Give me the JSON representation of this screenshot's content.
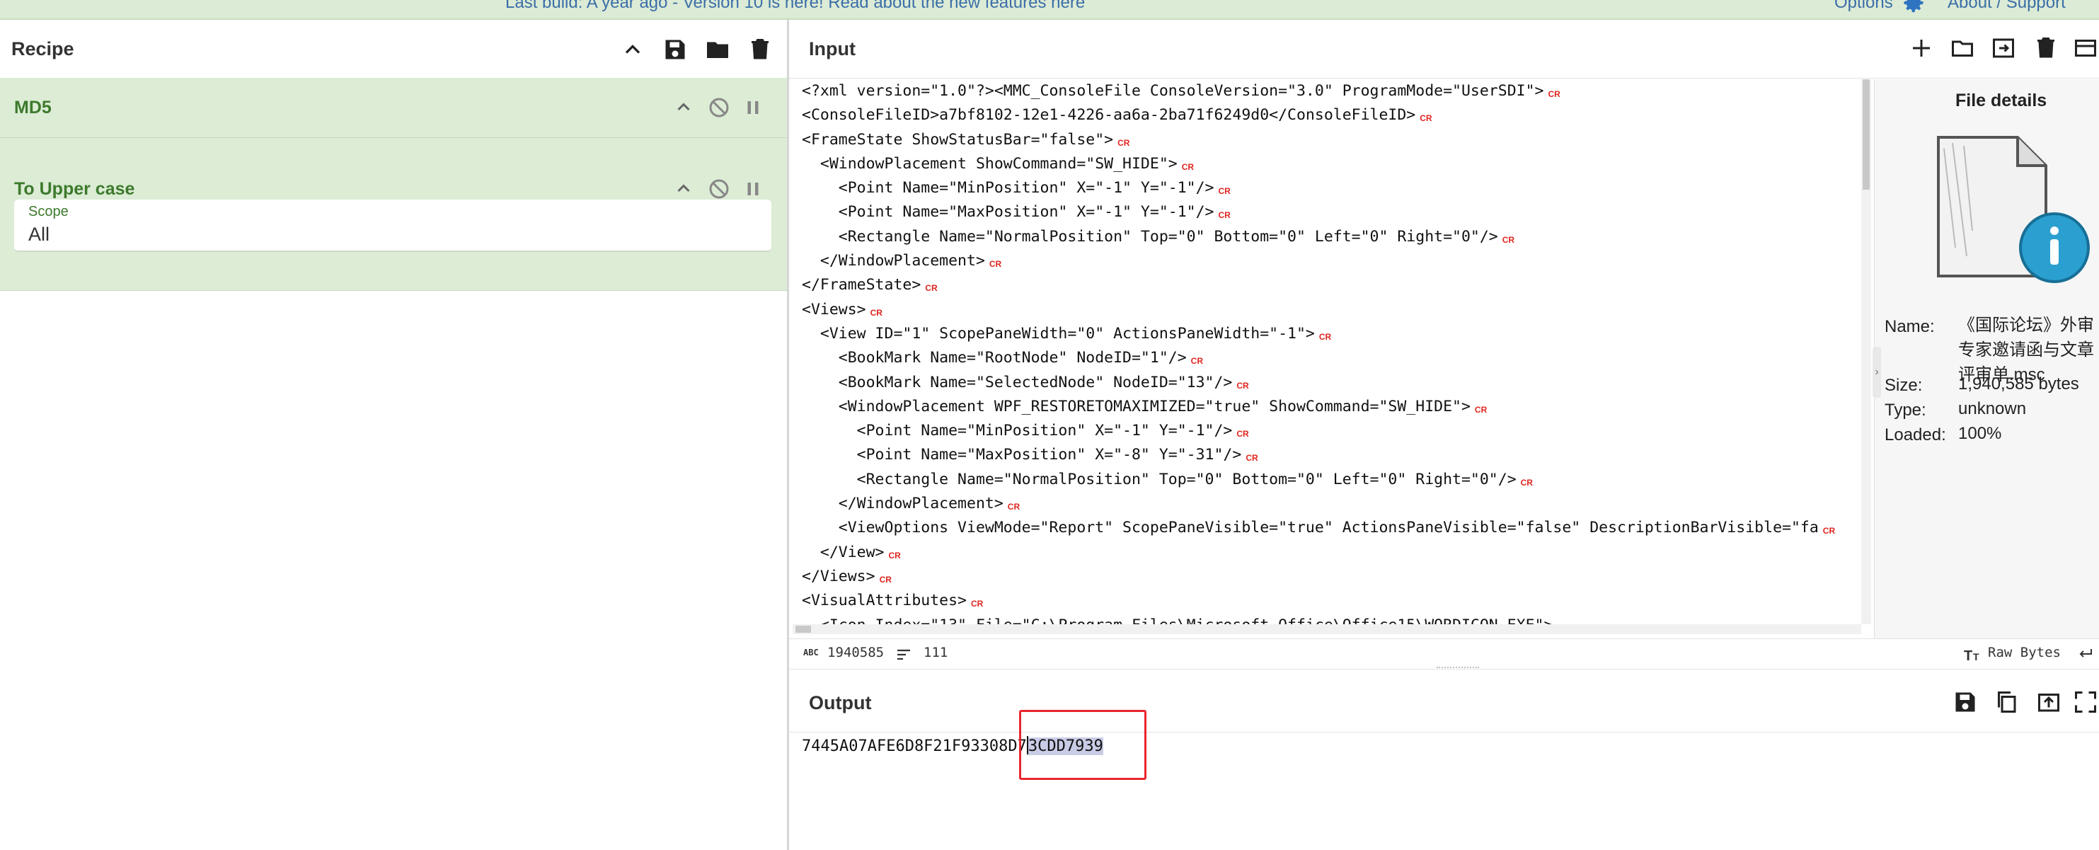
{
  "topbar": {
    "notice": "Last build: A year ago - Version 10 is here! Read about the new features",
    "notice_link": "here",
    "options": "Options",
    "about": "About / Support"
  },
  "recipe": {
    "title": "Recipe",
    "operations": [
      {
        "name": "MD5"
      },
      {
        "name": "To Upper case",
        "scope_label": "Scope",
        "scope_value": "All"
      }
    ]
  },
  "input": {
    "title": "Input",
    "lines": [
      "<?xml version=\"1.0\"?><MMC_ConsoleFile ConsoleVersion=\"3.0\" ProgramMode=\"UserSDI\">",
      "<ConsoleFileID>a7bf8102-12e1-4226-aa6a-2ba71f6249d0</ConsoleFileID>",
      "<FrameState ShowStatusBar=\"false\">",
      "  <WindowPlacement ShowCommand=\"SW_HIDE\">",
      "    <Point Name=\"MinPosition\" X=\"-1\" Y=\"-1\"/>",
      "    <Point Name=\"MaxPosition\" X=\"-1\" Y=\"-1\"/>",
      "    <Rectangle Name=\"NormalPosition\" Top=\"0\" Bottom=\"0\" Left=\"0\" Right=\"0\"/>",
      "  </WindowPlacement>",
      "</FrameState>",
      "<Views>",
      "  <View ID=\"1\" ScopePaneWidth=\"0\" ActionsPaneWidth=\"-1\">",
      "    <BookMark Name=\"RootNode\" NodeID=\"1\"/>",
      "    <BookMark Name=\"SelectedNode\" NodeID=\"13\"/>",
      "    <WindowPlacement WPF_RESTORETOMAXIMIZED=\"true\" ShowCommand=\"SW_HIDE\">",
      "      <Point Name=\"MinPosition\" X=\"-1\" Y=\"-1\"/>",
      "      <Point Name=\"MaxPosition\" X=\"-8\" Y=\"-31\"/>",
      "      <Rectangle Name=\"NormalPosition\" Top=\"0\" Bottom=\"0\" Left=\"0\" Right=\"0\"/>",
      "    </WindowPlacement>",
      "    <ViewOptions ViewMode=\"Report\" ScopePaneVisible=\"true\" ActionsPaneVisible=\"false\" DescriptionBarVisible=\"fa",
      "  </View>",
      "</Views>",
      "<VisualAttributes>",
      "  <Icon Index=\"13\" File=\"C:\\Program Files\\Microsoft Office\\Office15\\WORDICON.EXE\">"
    ],
    "cr_marker": "CR",
    "lines_with_cr": 22
  },
  "file_details": {
    "title": "File details",
    "name_label": "Name:",
    "name_value": [
      "《国际论坛》外审",
      "专家邀请函与文章",
      "评审单.msc"
    ],
    "size_label": "Size:",
    "size_value": "1,940,585 bytes",
    "type_label": "Type:",
    "type_value": "unknown",
    "loaded_label": "Loaded:",
    "loaded_value": "100%"
  },
  "status": {
    "abc_label": "ABC",
    "length": "1940585",
    "lines": "111",
    "encoding": "Raw Bytes"
  },
  "output": {
    "title": "Output",
    "text_before": "7445A07AFE6D8F21F93308D7",
    "text_selected": "3CDD7939"
  }
}
